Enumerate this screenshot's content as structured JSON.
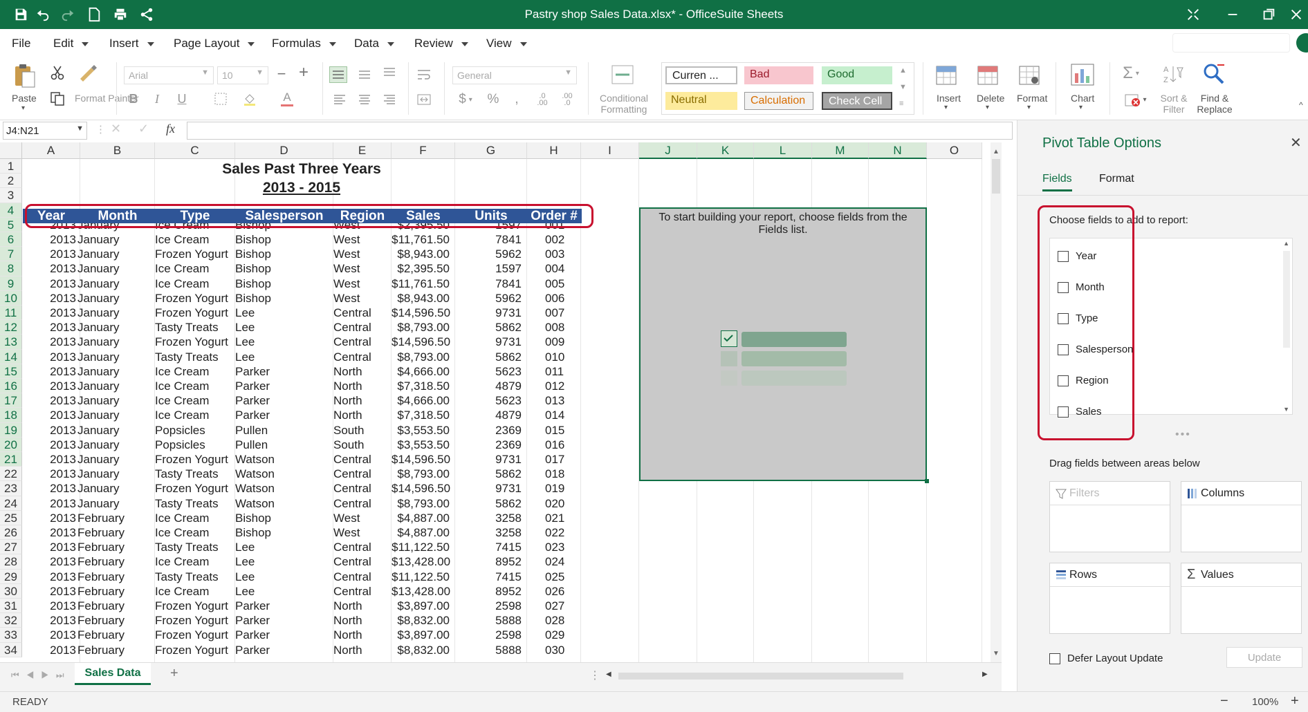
{
  "window": {
    "title": "Pastry shop Sales Data.xlsx* - OfficeSuite Sheets"
  },
  "menu": [
    "File",
    "Edit",
    "Insert",
    "Page Layout",
    "Formulas",
    "Data",
    "Review",
    "View"
  ],
  "ribbon": {
    "paste": "Paste",
    "format_painter": "Format Painter",
    "font_name": "Arial",
    "font_size": "10",
    "number_format": "General",
    "conditional_formatting": "Conditional Formatting",
    "styles": [
      "Curren ...",
      "Bad",
      "Good",
      "Neutral",
      "Calculation",
      "Check Cell"
    ],
    "insert": "Insert",
    "delete": "Delete",
    "format": "Format",
    "chart": "Chart",
    "sort_filter": "Sort & Filter",
    "find_replace": "Find & Replace"
  },
  "formula_bar": {
    "name_box": "J4:N21",
    "fx": "fx",
    "formula": ""
  },
  "columns": [
    "A",
    "B",
    "C",
    "D",
    "E",
    "F",
    "G",
    "H",
    "I",
    "J",
    "K",
    "L",
    "M",
    "N",
    "O"
  ],
  "sheet": {
    "title": "Sales Past Three Years",
    "subtitle": "2013 - 2015",
    "headers": [
      "Year",
      "Month",
      "Type",
      "Salesperson",
      "Region",
      "Sales",
      "Units",
      "Order #"
    ],
    "rows": [
      [
        "2013",
        "January",
        "Ice Cream",
        "Bishop",
        "West",
        "$2,395.50",
        "1597",
        "001"
      ],
      [
        "2013",
        "January",
        "Ice Cream",
        "Bishop",
        "West",
        "$11,761.50",
        "7841",
        "002"
      ],
      [
        "2013",
        "January",
        "Frozen Yogurt",
        "Bishop",
        "West",
        "$8,943.00",
        "5962",
        "003"
      ],
      [
        "2013",
        "January",
        "Ice Cream",
        "Bishop",
        "West",
        "$2,395.50",
        "1597",
        "004"
      ],
      [
        "2013",
        "January",
        "Ice Cream",
        "Bishop",
        "West",
        "$11,761.50",
        "7841",
        "005"
      ],
      [
        "2013",
        "January",
        "Frozen Yogurt",
        "Bishop",
        "West",
        "$8,943.00",
        "5962",
        "006"
      ],
      [
        "2013",
        "January",
        "Frozen Yogurt",
        "Lee",
        "Central",
        "$14,596.50",
        "9731",
        "007"
      ],
      [
        "2013",
        "January",
        "Tasty Treats",
        "Lee",
        "Central",
        "$8,793.00",
        "5862",
        "008"
      ],
      [
        "2013",
        "January",
        "Frozen Yogurt",
        "Lee",
        "Central",
        "$14,596.50",
        "9731",
        "009"
      ],
      [
        "2013",
        "January",
        "Tasty Treats",
        "Lee",
        "Central",
        "$8,793.00",
        "5862",
        "010"
      ],
      [
        "2013",
        "January",
        "Ice Cream",
        "Parker",
        "North",
        "$4,666.00",
        "5623",
        "011"
      ],
      [
        "2013",
        "January",
        "Ice Cream",
        "Parker",
        "North",
        "$7,318.50",
        "4879",
        "012"
      ],
      [
        "2013",
        "January",
        "Ice Cream",
        "Parker",
        "North",
        "$4,666.00",
        "5623",
        "013"
      ],
      [
        "2013",
        "January",
        "Ice Cream",
        "Parker",
        "North",
        "$7,318.50",
        "4879",
        "014"
      ],
      [
        "2013",
        "January",
        "Popsicles",
        "Pullen",
        "South",
        "$3,553.50",
        "2369",
        "015"
      ],
      [
        "2013",
        "January",
        "Popsicles",
        "Pullen",
        "South",
        "$3,553.50",
        "2369",
        "016"
      ],
      [
        "2013",
        "January",
        "Frozen Yogurt",
        "Watson",
        "Central",
        "$14,596.50",
        "9731",
        "017"
      ],
      [
        "2013",
        "January",
        "Tasty Treats",
        "Watson",
        "Central",
        "$8,793.00",
        "5862",
        "018"
      ],
      [
        "2013",
        "January",
        "Frozen Yogurt",
        "Watson",
        "Central",
        "$14,596.50",
        "9731",
        "019"
      ],
      [
        "2013",
        "January",
        "Tasty Treats",
        "Watson",
        "Central",
        "$8,793.00",
        "5862",
        "020"
      ],
      [
        "2013",
        "February",
        "Ice Cream",
        "Bishop",
        "West",
        "$4,887.00",
        "3258",
        "021"
      ],
      [
        "2013",
        "February",
        "Ice Cream",
        "Bishop",
        "West",
        "$4,887.00",
        "3258",
        "022"
      ],
      [
        "2013",
        "February",
        "Tasty Treats",
        "Lee",
        "Central",
        "$11,122.50",
        "7415",
        "023"
      ],
      [
        "2013",
        "February",
        "Ice Cream",
        "Lee",
        "Central",
        "$13,428.00",
        "8952",
        "024"
      ],
      [
        "2013",
        "February",
        "Tasty Treats",
        "Lee",
        "Central",
        "$11,122.50",
        "7415",
        "025"
      ],
      [
        "2013",
        "February",
        "Ice Cream",
        "Lee",
        "Central",
        "$13,428.00",
        "8952",
        "026"
      ],
      [
        "2013",
        "February",
        "Frozen Yogurt",
        "Parker",
        "North",
        "$3,897.00",
        "2598",
        "027"
      ],
      [
        "2013",
        "February",
        "Frozen Yogurt",
        "Parker",
        "North",
        "$8,832.00",
        "5888",
        "028"
      ],
      [
        "2013",
        "February",
        "Frozen Yogurt",
        "Parker",
        "North",
        "$3,897.00",
        "2598",
        "029"
      ],
      [
        "2013",
        "February",
        "Frozen Yogurt",
        "Parker",
        "North",
        "$8,832.00",
        "5888",
        "030"
      ]
    ]
  },
  "pivot_placeholder": "To start building your report, choose fields from the Fields list.",
  "pivot_panel": {
    "title": "Pivot Table Options",
    "tabs": [
      "Fields",
      "Format"
    ],
    "choose_label": "Choose fields to add to report:",
    "fields": [
      "Year",
      "Month",
      "Type",
      "Salesperson",
      "Region",
      "Sales"
    ],
    "drag_label": "Drag fields between areas below",
    "areas": [
      "Filters",
      "Columns",
      "Rows",
      "Values"
    ],
    "defer_label": "Defer Layout Update",
    "update_button": "Update"
  },
  "sheet_tab": "Sales Data",
  "status": {
    "ready": "READY",
    "zoom": "100%"
  },
  "colors": {
    "accent": "#107045",
    "header_blue": "#2f5597",
    "highlight": "#c8102e"
  }
}
